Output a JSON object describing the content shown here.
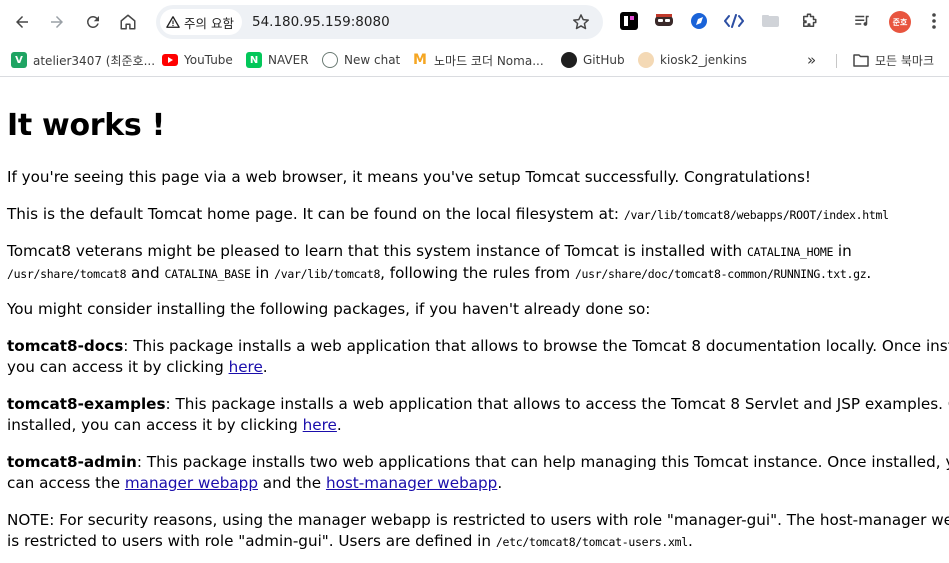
{
  "browser": {
    "security_label": "주의 요함",
    "url": "54.180.95.159:8080",
    "profile_initials": "준호",
    "bookmarks": [
      {
        "label": "atelier3407 (최준호...",
        "icon": "v-favicon",
        "color": "#1fa463"
      },
      {
        "label": "YouTube",
        "icon": "youtube-favicon",
        "color": "#ff0000"
      },
      {
        "label": "NAVER",
        "icon": "naver-favicon",
        "color": "#03c75a"
      },
      {
        "label": "New chat",
        "icon": "chatgpt-favicon",
        "color": "#10a37f"
      },
      {
        "label": "노마드 코더 Noma...",
        "icon": "nomad-favicon",
        "color": "#f5a623"
      },
      {
        "label": "GitHub",
        "icon": "github-favicon",
        "color": "#1f1f1f"
      },
      {
        "label": "kiosk2_jenkins",
        "icon": "jenkins-favicon",
        "color": "#d33833"
      }
    ],
    "bookmarks_folder": "모든 북마크"
  },
  "page": {
    "title": "It works !",
    "p1": "If you're seeing this page via a web browser, it means you've setup Tomcat successfully. Congratulations!",
    "p2_text": "This is the default Tomcat home page. It can be found on the local filesystem at: ",
    "p2_path": "/var/lib/tomcat8/webapps/ROOT/index.html",
    "p3_a": "Tomcat8 veterans might be pleased to learn that this system instance of Tomcat is installed with ",
    "p3_catalina_home": "CATALINA_HOME",
    "p3_b": " in",
    "p3_home_path": "/usr/share/tomcat8",
    "p3_c": " and ",
    "p3_catalina_base": "CATALINA_BASE",
    "p3_d": " in ",
    "p3_base_path": "/var/lib/tomcat8",
    "p3_e": ", following the rules from ",
    "p3_running_path": "/usr/share/doc/tomcat8-common/RUNNING.txt.gz",
    "p3_f": ".",
    "p4": "You might consider installing the following packages, if you haven't already done so:",
    "docs_name": "tomcat8-docs",
    "docs_a": ": This package installs a web application that allows to browse the Tomcat 8 documentation locally. Once installed,",
    "docs_b": "you can access it by clicking ",
    "docs_link": "here",
    "docs_c": ".",
    "examples_name": "tomcat8-examples",
    "examples_a": ": This package installs a web application that allows to access the Tomcat 8 Servlet and JSP examples. Once",
    "examples_b": "installed, you can access it by clicking ",
    "examples_link": "here",
    "examples_c": ".",
    "admin_name": "tomcat8-admin",
    "admin_a": ": This package installs two web applications that can help managing this Tomcat instance. Once installed, you",
    "admin_b": "can access the ",
    "admin_link1": "manager webapp",
    "admin_c": " and the ",
    "admin_link2": "host-manager webapp",
    "admin_d": ".",
    "note_a": "NOTE: For security reasons, using the manager webapp is restricted to users with role \"manager-gui\". The host-manager webapp",
    "note_b": "is restricted to users with role \"admin-gui\". Users are defined in ",
    "note_path": "/etc/tomcat8/tomcat-users.xml",
    "note_c": "."
  }
}
